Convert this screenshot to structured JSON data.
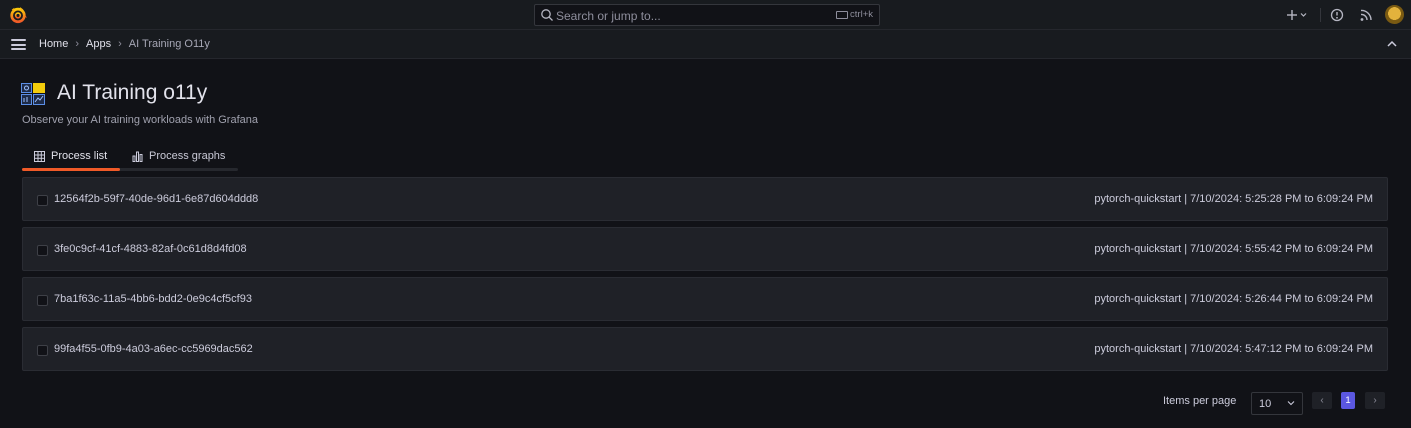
{
  "topbar": {
    "search_placeholder": "Search or jump to...",
    "search_shortcut": "ctrl+k"
  },
  "breadcrumb": {
    "home": "Home",
    "apps": "Apps",
    "current": "AI Training O11y"
  },
  "page": {
    "title": "AI Training o11y",
    "subtitle": "Observe your AI training workloads with Grafana"
  },
  "tabs": [
    {
      "label": "Process list",
      "active": true
    },
    {
      "label": "Process graphs",
      "active": false
    }
  ],
  "processes": [
    {
      "id": "12564f2b-59f7-40de-96d1-6e87d604ddd8",
      "meta": "pytorch-quickstart | 7/10/2024: 5:25:28 PM to 6:09:24 PM"
    },
    {
      "id": "3fe0c9cf-41cf-4883-82af-0c61d8d4fd08",
      "meta": "pytorch-quickstart | 7/10/2024: 5:55:42 PM to 6:09:24 PM"
    },
    {
      "id": "7ba1f63c-11a5-4bb6-bdd2-0e9c4cf5cf93",
      "meta": "pytorch-quickstart | 7/10/2024: 5:26:44 PM to 6:09:24 PM"
    },
    {
      "id": "99fa4f55-0fb9-4a03-a6ec-cc5969dac562",
      "meta": "pytorch-quickstart | 7/10/2024: 5:47:12 PM to 6:09:24 PM"
    }
  ],
  "pagination": {
    "items_per_page_label": "Items per page",
    "items_per_page_value": "10",
    "current_page": "1",
    "prev_icon": "chevron-left-icon",
    "next_icon": "chevron-right-icon"
  },
  "colors": {
    "accent": "#f05a28",
    "page_active": "#5b57e0",
    "background": "#111217"
  }
}
